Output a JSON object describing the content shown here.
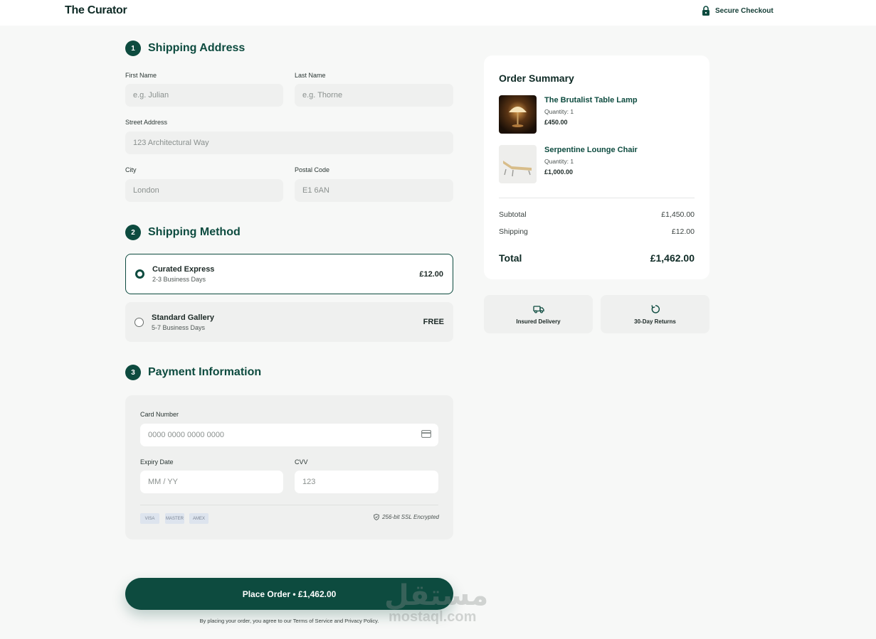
{
  "header": {
    "brand": "The Curator",
    "secure_label": "Secure Checkout"
  },
  "shipping_address": {
    "step": "1",
    "title": "Shipping Address",
    "first_name": {
      "label": "First Name",
      "placeholder": "e.g. Julian"
    },
    "last_name": {
      "label": "Last Name",
      "placeholder": "e.g. Thorne"
    },
    "street": {
      "label": "Street Address",
      "placeholder": "123 Architectural Way"
    },
    "city": {
      "label": "City",
      "placeholder": "London"
    },
    "postal": {
      "label": "Postal Code",
      "placeholder": "E1 6AN"
    }
  },
  "shipping_method": {
    "step": "2",
    "title": "Shipping Method",
    "options": [
      {
        "name": "Curated Express",
        "eta": "2-3 Business Days",
        "price": "£12.00",
        "selected": true
      },
      {
        "name": "Standard Gallery",
        "eta": "5-7 Business Days",
        "price": "FREE",
        "selected": false
      }
    ]
  },
  "payment": {
    "step": "3",
    "title": "Payment Information",
    "card_number": {
      "label": "Card Number",
      "placeholder": "0000 0000 0000 0000"
    },
    "expiry": {
      "label": "Expiry Date",
      "placeholder": "MM / YY"
    },
    "cvv": {
      "label": "CVV",
      "placeholder": "123"
    },
    "card_brands": [
      "VISA",
      "MASTER",
      "AMEX"
    ],
    "ssl_note": "256-bit SSL Encrypted"
  },
  "cta": {
    "place_order": "Place Order • £1,462.00",
    "terms": "By placing your order, you agree to our Terms of Service and Privacy Policy."
  },
  "order_summary": {
    "title": "Order Summary",
    "items": [
      {
        "name": "The Brutalist Table Lamp",
        "quantity": "Quantity: 1",
        "price": "£450.00",
        "thumb": "lamp-image"
      },
      {
        "name": "Serpentine Lounge Chair",
        "quantity": "Quantity: 1",
        "price": "£1,000.00",
        "thumb": "lounge-chair-image"
      }
    ],
    "subtotal_label": "Subtotal",
    "subtotal_value": "£1,450.00",
    "shipping_label": "Shipping",
    "shipping_value": "£12.00",
    "total_label": "Total",
    "total_value": "£1,462.00"
  },
  "badges": [
    {
      "icon": "truck-icon",
      "label": "Insured Delivery"
    },
    {
      "icon": "return-icon",
      "label": "30-Day Returns"
    }
  ],
  "watermark": {
    "arabic": "مستقل",
    "latin": "mostaql.com"
  },
  "colors": {
    "brand_green": "#0d4b3f",
    "page_bg": "#f7f8f7",
    "field_bg": "#eff0ef"
  }
}
